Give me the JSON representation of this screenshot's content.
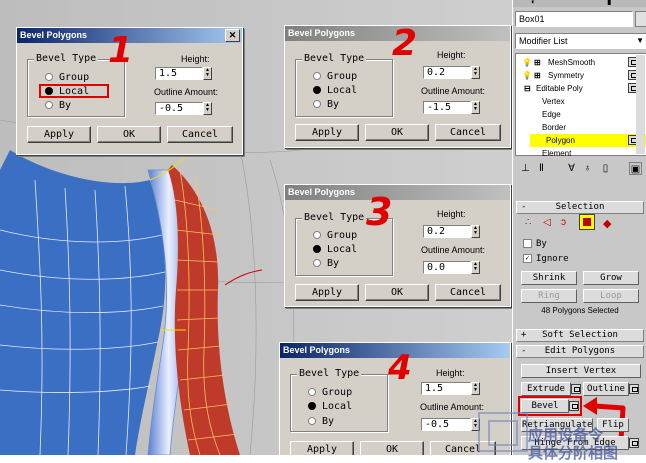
{
  "dialogs": [
    {
      "title": "Bevel Polygons",
      "bevel_type": "Bevel Type",
      "options": [
        "Group",
        "Local",
        "By"
      ],
      "selected": 1,
      "height_label": "Height:",
      "height": "1.5",
      "outline_label": "Outline Amount:",
      "outline": "-0.5",
      "buttons": [
        "Apply",
        "OK",
        "Cancel"
      ],
      "step": "1"
    },
    {
      "title": "Bevel Polygons",
      "bevel_type": "Bevel Type",
      "options": [
        "Group",
        "Local",
        "By"
      ],
      "selected": 1,
      "height_label": "Height:",
      "height": "0.2",
      "outline_label": "Outline Amount:",
      "outline": "-1.5",
      "buttons": [
        "Apply",
        "OK",
        "Cancel"
      ],
      "step": "2"
    },
    {
      "title": "Bevel Polygons",
      "bevel_type": "Bevel Type",
      "options": [
        "Group",
        "Local",
        "By"
      ],
      "selected": 1,
      "height_label": "Height:",
      "height": "0.2",
      "outline_label": "Outline Amount:",
      "outline": "0.0",
      "buttons": [
        "Apply",
        "OK",
        "Cancel"
      ],
      "step": "3"
    },
    {
      "title": "Bevel Polygons",
      "bevel_type": "Bevel Type",
      "options": [
        "Group",
        "Local",
        "By"
      ],
      "selected": 1,
      "height_label": "Height:",
      "height": "1.5",
      "outline_label": "Outline Amount:",
      "outline": "-0.5",
      "buttons": [
        "Apply",
        "OK",
        "Cancel"
      ],
      "step": "4"
    }
  ],
  "panel": {
    "object_name": "Box01",
    "modifier_list": "Modifier List",
    "stack": [
      "MeshSmooth",
      "Symmetry",
      "Editable Poly",
      "Vertex",
      "Edge",
      "Border",
      "Polygon",
      "Element"
    ],
    "selection_title": "Selection",
    "by_label": "By",
    "ignore_label": "Ignore",
    "shrink": "Shrink",
    "grow": "Grow",
    "ring": "Ring",
    "loop": "Loop",
    "selected_count": "48 Polygons Selected",
    "soft_selection": "Soft Selection",
    "edit_polygons": "Edit Polygons",
    "insert_vertex": "Insert Vertex",
    "extrude": "Extrude",
    "outline": "Outline",
    "bevel": "Bevel",
    "retriangulate": "Retriangulate",
    "flip": "Flip",
    "hinge": "Hinge From Edge"
  },
  "watermark": [
    "应用设备令",
    "具体分阶相图"
  ],
  "colors": {
    "blue_mesh": "#3a6fc4",
    "red_mesh": "#c03a2a",
    "highlight": "#ffff00",
    "annotation": "#e00000"
  }
}
